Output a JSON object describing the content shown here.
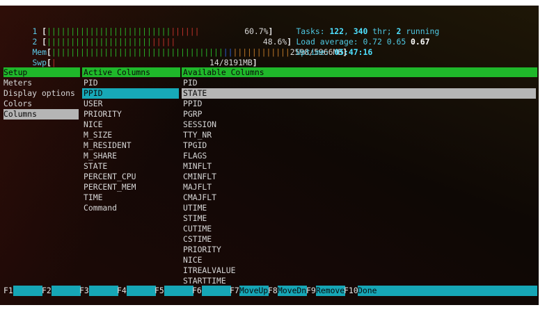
{
  "meters": {
    "cpu1": {
      "label": "1",
      "bar": "||||||||||||||||||||||||||||||",
      "value": "60.7%"
    },
    "cpu2": {
      "label": "2",
      "bar": "||||||||||||||||||||||||",
      "value": "48.6%"
    },
    "mem": {
      "label": "Mem",
      "value": "2598/5966MB"
    },
    "swp": {
      "label": "Swp",
      "value": "14/8191MB"
    }
  },
  "stats": {
    "tasks_label": "Tasks: ",
    "tasks": "122",
    "sep1": ", ",
    "threads": "340",
    "thr_label": " thr; ",
    "running": "2",
    "running_label": " running",
    "load_label": "Load average: ",
    "load1": "0.72",
    "load5": "0.65",
    "load15": "0.67",
    "uptime_label": "Uptime: ",
    "uptime": "05:47:16"
  },
  "setup": {
    "header": "Setup",
    "items": [
      "Meters",
      "Display options",
      "Colors",
      "Columns"
    ],
    "selected": 3
  },
  "active_columns": {
    "header": "Active Columns",
    "items": [
      "PID",
      "PPID",
      "USER",
      "PRIORITY",
      "NICE",
      "M_SIZE",
      "M_RESIDENT",
      "M_SHARE",
      "STATE",
      "PERCENT_CPU",
      "PERCENT_MEM",
      "TIME",
      "Command"
    ],
    "selected": 1
  },
  "available_columns": {
    "header": "Available Columns",
    "items": [
      "PID",
      "STATE",
      "PPID",
      "PGRP",
      "SESSION",
      "TTY_NR",
      "TPGID",
      "FLAGS",
      "MINFLT",
      "CMINFLT",
      "MAJFLT",
      "CMAJFLT",
      "UTIME",
      "STIME",
      "CUTIME",
      "CSTIME",
      "PRIORITY",
      "NICE",
      "ITREALVALUE",
      "STARTTIME"
    ],
    "selected": 1
  },
  "function_keys": [
    {
      "key": "F1",
      "label": "      "
    },
    {
      "key": "F2",
      "label": "      "
    },
    {
      "key": "F3",
      "label": "      "
    },
    {
      "key": "F4",
      "label": "      "
    },
    {
      "key": "F5",
      "label": "      "
    },
    {
      "key": "F6",
      "label": "      "
    },
    {
      "key": "F7",
      "label": "MoveUp"
    },
    {
      "key": "F8",
      "label": "MoveDn"
    },
    {
      "key": "F9",
      "label": "Remove"
    },
    {
      "key": "F10",
      "label": "Done  "
    }
  ]
}
